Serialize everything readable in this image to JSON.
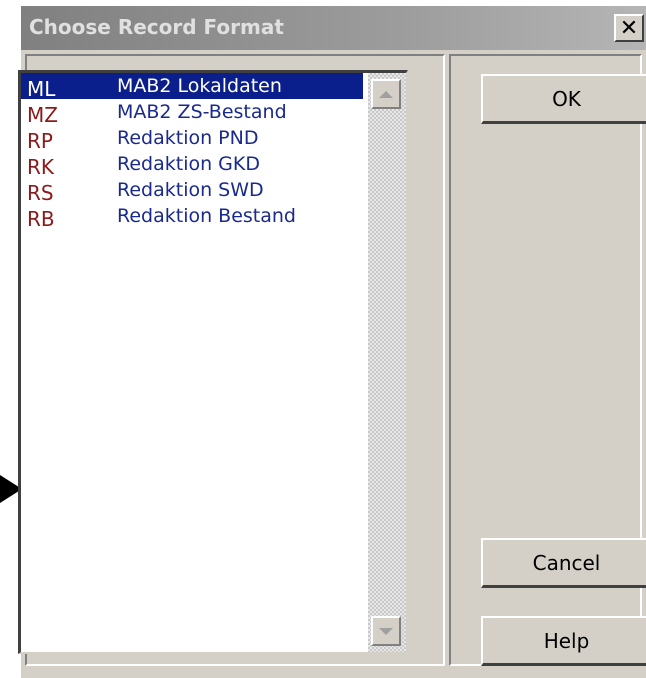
{
  "dialog": {
    "title": "Choose Record Format",
    "close_glyph": "✕"
  },
  "list": {
    "items": [
      {
        "code": "ML",
        "name": "MAB2 Lokaldaten",
        "selected": true
      },
      {
        "code": "MZ",
        "name": "MAB2 ZS-Bestand",
        "selected": false
      },
      {
        "code": "RP",
        "name": "Redaktion PND",
        "selected": false
      },
      {
        "code": "RK",
        "name": "Redaktion GKD",
        "selected": false
      },
      {
        "code": "RS",
        "name": "Redaktion SWD",
        "selected": false
      },
      {
        "code": "RB",
        "name": "Redaktion Bestand",
        "selected": false
      }
    ]
  },
  "buttons": {
    "ok": "OK",
    "cancel": "Cancel",
    "help": "Help"
  },
  "colors": {
    "selection": "#0a1e8c",
    "code_text": "#8b1a1a",
    "name_text": "#1a2a8c"
  },
  "icons": {
    "pointer": "arrow-pointer-icon",
    "close": "close-icon",
    "scroll_up": "scroll-up-arrow-icon",
    "scroll_down": "scroll-down-arrow-icon"
  }
}
